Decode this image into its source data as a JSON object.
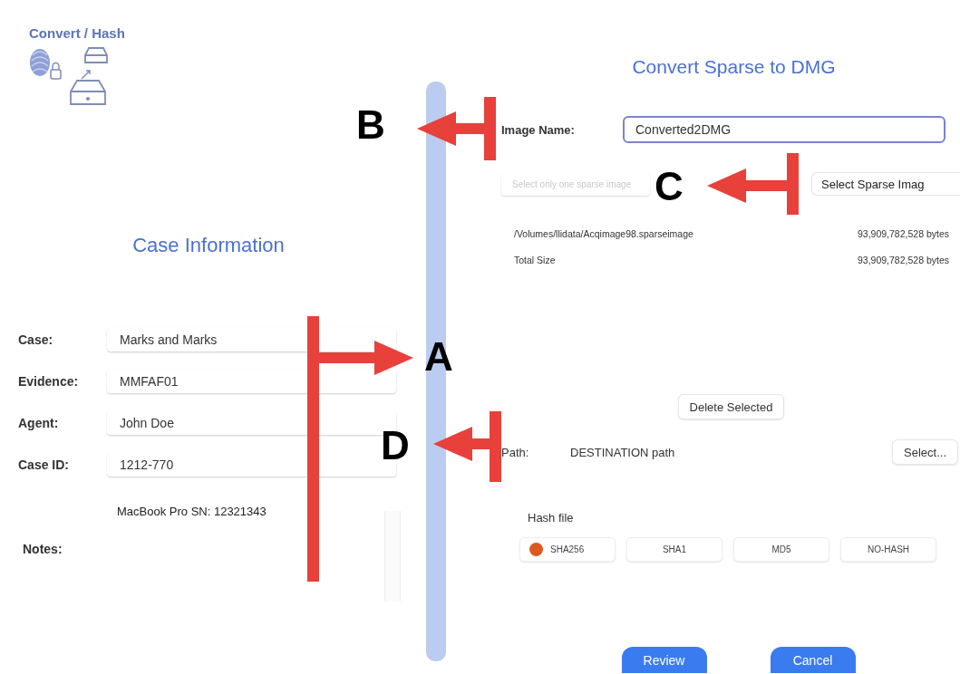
{
  "logo": {
    "title": "Convert / Hash"
  },
  "case_panel": {
    "heading": "Case Information",
    "fields": [
      {
        "label": "Case:",
        "value": "Marks and Marks"
      },
      {
        "label": "Evidence:",
        "value": "MMFAF01"
      },
      {
        "label": "Agent:",
        "value": "John Doe"
      },
      {
        "label": "Case ID:",
        "value": "1212-770"
      }
    ],
    "device": "MacBook Pro SN: 12321343",
    "notes_label": "Notes:"
  },
  "convert_panel": {
    "title": "Convert Sparse to DMG",
    "image_name": {
      "label": "Image Name:",
      "value": "Converted2DMG",
      "focused": true
    },
    "sparse": {
      "placeholder": "Select only one sparse image",
      "button": "Select Sparse Imag"
    },
    "files": [
      {
        "path": "/Volumes/llidata/Acqimage98.sparseimage",
        "size": "93,909,782,528 bytes"
      },
      {
        "path": "Total Size",
        "size": "93,909,782,528 bytes"
      }
    ],
    "delete_button": "Delete Selected",
    "destination": {
      "label": "Path:",
      "value": "DESTINATION path",
      "button": "Select..."
    },
    "hash": {
      "label": "Hash file",
      "options": [
        {
          "label": "SHA256",
          "selected": true
        },
        {
          "label": "SHA1",
          "selected": false
        },
        {
          "label": "MD5",
          "selected": false
        },
        {
          "label": "NO-HASH",
          "selected": false
        }
      ]
    },
    "buttons": [
      "Review",
      "Cancel"
    ]
  },
  "annotations": [
    {
      "letter": "A",
      "kind": "arrow_right"
    },
    {
      "letter": "B",
      "kind": "arrow_left"
    },
    {
      "letter": "C",
      "kind": "arrow_left"
    },
    {
      "letter": "D",
      "kind": "arrow_left"
    }
  ]
}
